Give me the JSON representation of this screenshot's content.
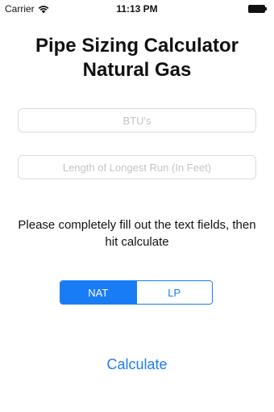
{
  "status_bar": {
    "carrier": "Carrier",
    "time": "11:13 PM",
    "wifi_icon": "wifi-icon",
    "battery_icon": "battery-icon"
  },
  "title": {
    "line1": "Pipe Sizing Calculator",
    "line2": "Natural Gas"
  },
  "fields": {
    "btu": {
      "value": "",
      "placeholder": "BTU's"
    },
    "length": {
      "value": "",
      "placeholder": "Length of Longest Run (In Feet)"
    }
  },
  "instructions": "Please completely fill out the text fields, then hit calculate",
  "gas_type": {
    "options": [
      "NAT",
      "LP"
    ],
    "selected": "NAT"
  },
  "calculate_label": "Calculate",
  "colors": {
    "accent": "#1a7cf5",
    "field_border": "#dcdcdc",
    "placeholder": "#c4c4c4"
  }
}
